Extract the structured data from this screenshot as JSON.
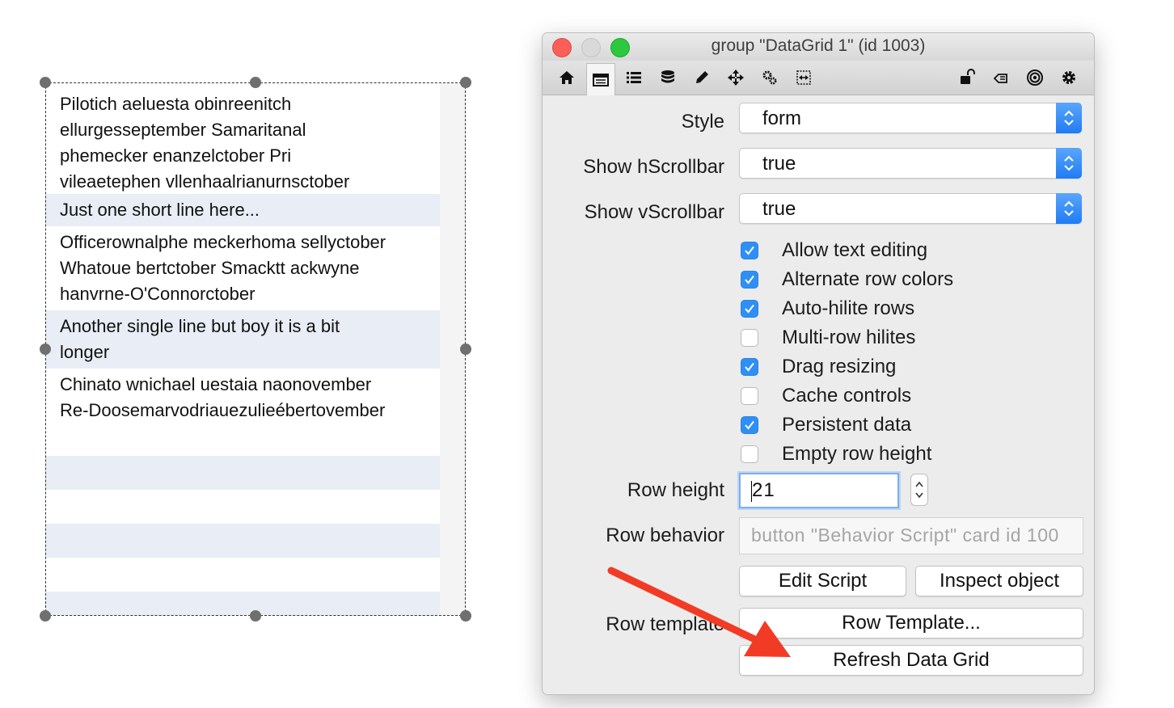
{
  "grid": {
    "rows": [
      {
        "text": "Pilotich aeluesta obinreenitch\nellurgesseptember Samaritanal\nphemecker enanzelctober Pri\nvileaetephen vllenhaalrianurnsctober"
      },
      {
        "text": "Just one short line here..."
      },
      {
        "text": "Officerownalphe meckerhoma sellyctober\nWhatoue bertctober Smacktt ackwyne\nhanvrne-O'Connorctober"
      },
      {
        "text": "Another single line but boy it is a bit\nlonger"
      },
      {
        "text": "Chinato wnichael uestaia naonovember\nRe-Doosemarvodriauezulieébertovember"
      }
    ]
  },
  "window": {
    "title": "group \"DataGrid 1\" (id 1003)",
    "toolbar_icons": [
      "home-icon",
      "table-icon",
      "list-icon",
      "database-icon",
      "pencil-icon",
      "move-icon",
      "gears-icon",
      "resize-icon",
      "lock-icon",
      "message-icon",
      "target-icon",
      "gear-icon"
    ]
  },
  "props": {
    "style_label": "Style",
    "style_value": "form",
    "hscroll_label": "Show hScrollbar",
    "hscroll_value": "true",
    "vscroll_label": "Show vScrollbar",
    "vscroll_value": "true",
    "checkboxes": [
      {
        "label": "Allow text editing",
        "checked": true
      },
      {
        "label": "Alternate row colors",
        "checked": true
      },
      {
        "label": "Auto-hilite rows",
        "checked": true
      },
      {
        "label": "Multi-row hilites",
        "checked": false
      },
      {
        "label": "Drag resizing",
        "checked": true
      },
      {
        "label": "Cache controls",
        "checked": false
      },
      {
        "label": "Persistent data",
        "checked": true
      },
      {
        "label": "Empty row height",
        "checked": false
      }
    ],
    "row_height_label": "Row height",
    "row_height_value": "21",
    "row_behavior_label": "Row behavior",
    "row_behavior_value": "button \"Behavior Script\" card  id 100",
    "edit_script": "Edit Script",
    "inspect_object": "Inspect object",
    "row_template_label": "Row template",
    "row_template_button": "Row Template...",
    "refresh_button": "Refresh Data Grid"
  },
  "colors": {
    "accent": "#2f8ff5",
    "alt_row": "#e8edf6",
    "annotation_arrow": "#f23b25"
  }
}
